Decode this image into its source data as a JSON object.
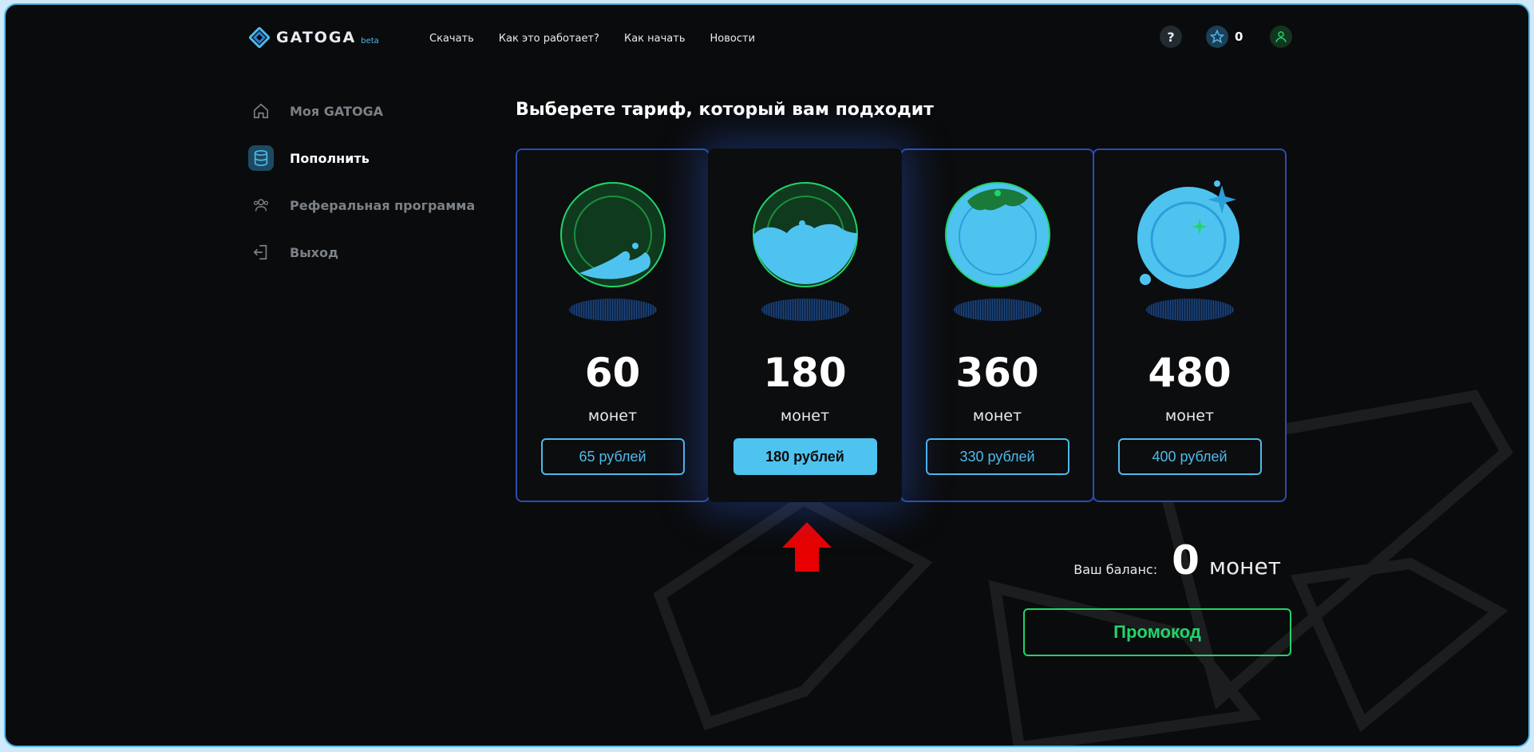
{
  "header": {
    "logo_text": "GATOGA",
    "logo_badge": "beta",
    "nav": [
      "Скачать",
      "Как это работает?",
      "Как начать",
      "Новости"
    ],
    "help_label": "?",
    "stars_count": "0"
  },
  "sidebar": {
    "items": [
      {
        "label": "Моя GATOGA",
        "icon": "home-icon"
      },
      {
        "label": "Пополнить",
        "icon": "database-icon",
        "active": true
      },
      {
        "label": "Реферальная программа",
        "icon": "users-icon"
      },
      {
        "label": "Выход",
        "icon": "logout-icon"
      }
    ]
  },
  "main": {
    "title": "Выберете тариф, который вам подходит",
    "plans": [
      {
        "amount": "60",
        "unit": "монет",
        "price": "65 рублей"
      },
      {
        "amount": "180",
        "unit": "монет",
        "price": "180 рублей",
        "highlighted": true
      },
      {
        "amount": "360",
        "unit": "монет",
        "price": "330 рублей"
      },
      {
        "amount": "480",
        "unit": "монет",
        "price": "400 рублей"
      }
    ],
    "balance_label": "Ваш баланс:",
    "balance_value": "0",
    "balance_unit": "монет",
    "promo_label": "Промокод"
  },
  "colors": {
    "background": "#0a0b0c",
    "accent_blue": "#4fb9ea",
    "card_border": "#2d4bb3",
    "promo_green": "#21d46a",
    "arrow_red": "#e80000"
  }
}
